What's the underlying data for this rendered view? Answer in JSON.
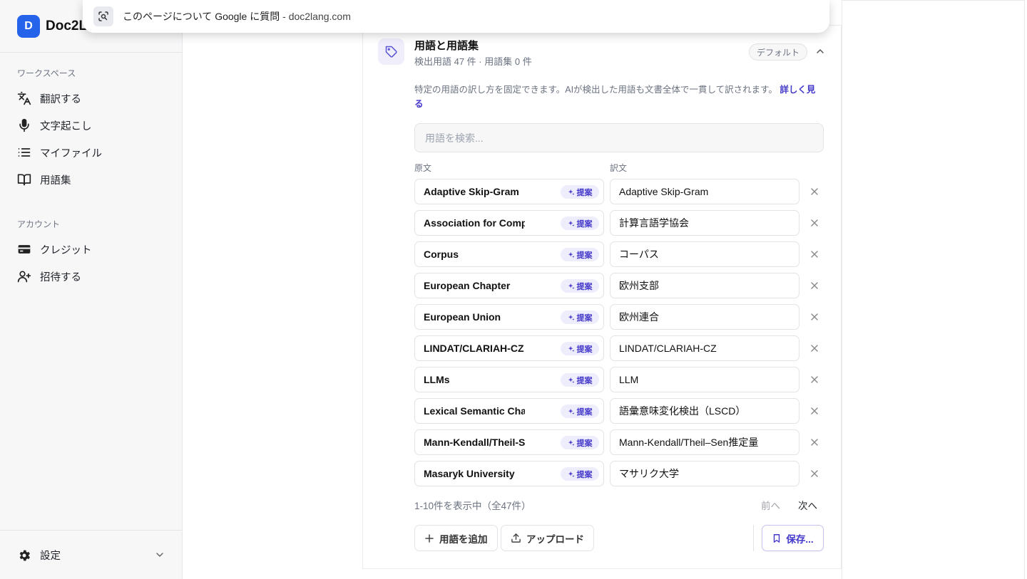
{
  "app": {
    "logo_letter": "D",
    "name": "Doc2L"
  },
  "google_bar": {
    "text": "このページについて Google に質問",
    "separator": " - ",
    "url": "doc2lang.com"
  },
  "sidebar": {
    "workspace_label": "ワークスペース",
    "workspace_items": [
      {
        "label": "翻訳する",
        "icon": "translate-icon"
      },
      {
        "label": "文字起こし",
        "icon": "microphone-icon"
      },
      {
        "label": "マイファイル",
        "icon": "list-icon"
      },
      {
        "label": "用語集",
        "icon": "book-icon"
      }
    ],
    "account_label": "アカウント",
    "account_items": [
      {
        "label": "クレジット",
        "icon": "credit-card-icon"
      },
      {
        "label": "招待する",
        "icon": "user-plus-icon"
      }
    ],
    "settings_label": "設定"
  },
  "glossary": {
    "title": "用語と用語集",
    "subtitle": "検出用語 47 件 · 用語集 0 件",
    "badge": "デフォルト",
    "description": "特定の用語の訳し方を固定できます。AIが検出した用語も文書全体で一貫して訳されます。",
    "learn_more": "詳しく見る",
    "search_placeholder": "用語を検索...",
    "col_source": "原文",
    "col_target": "訳文",
    "suggest_label": "提案",
    "rows": [
      {
        "source": "Adaptive Skip-Gram",
        "target": "Adaptive Skip-Gram"
      },
      {
        "source": "Association for Comp",
        "target": "計算言語学協会"
      },
      {
        "source": "Corpus",
        "target": "コーパス"
      },
      {
        "source": "European Chapter",
        "target": "欧州支部"
      },
      {
        "source": "European Union",
        "target": "欧州連合"
      },
      {
        "source": "LINDAT/CLARIAH-CZ",
        "target": "LINDAT/CLARIAH-CZ"
      },
      {
        "source": "LLMs",
        "target": "LLM"
      },
      {
        "source": "Lexical Semantic Cha",
        "target": "語彙意味変化検出（LSCD）"
      },
      {
        "source": "Mann-Kendall/Theil-S",
        "target": "Mann-Kendall/Theil–Sen推定量"
      },
      {
        "source": "Masaryk University",
        "target": "マサリク大学"
      }
    ],
    "pagination_info": "1-10件を表示中（全47件）",
    "prev_label": "前へ",
    "next_label": "次へ",
    "add_label": "用語を追加",
    "upload_label": "アップロード",
    "save_label": "保存..."
  },
  "colors": {
    "brand": "#2563eb",
    "accent": "#4338ca",
    "suggest_bg": "#eeedfb"
  }
}
